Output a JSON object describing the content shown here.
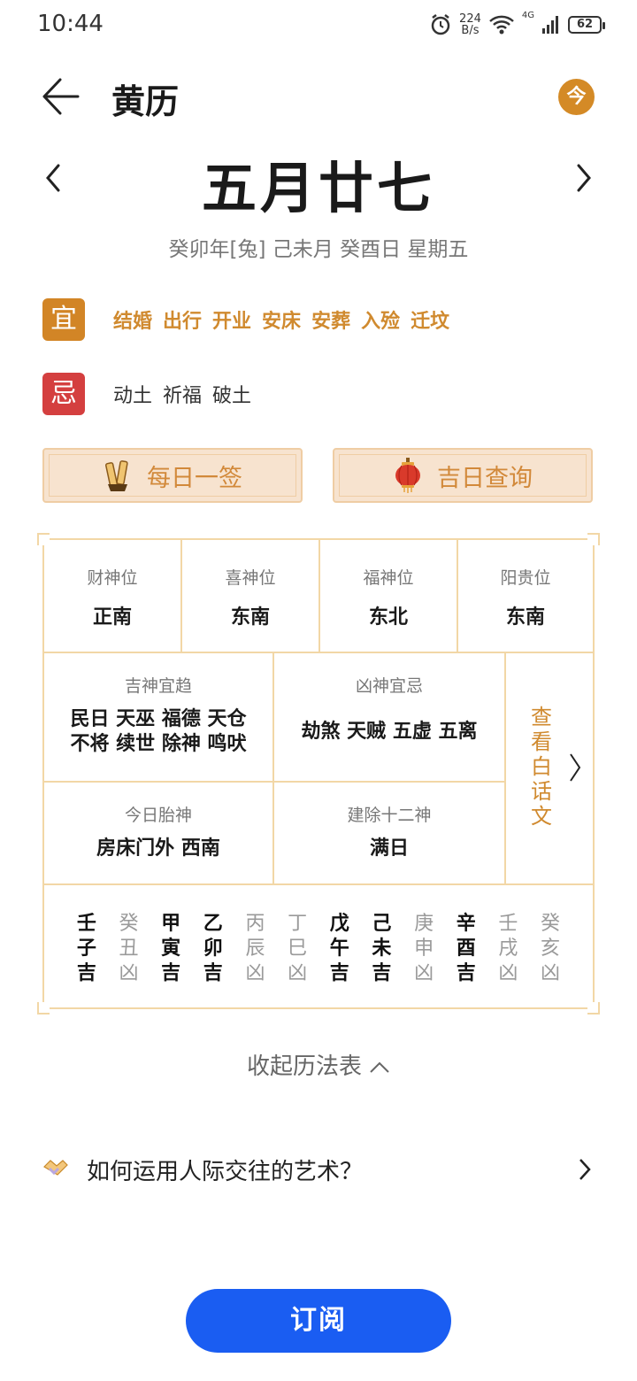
{
  "status_bar": {
    "time": "10:44",
    "net_speed_value": "224",
    "net_speed_unit": "B/s",
    "network": "4G",
    "battery": "62"
  },
  "header": {
    "title": "黄历",
    "today_label": "今"
  },
  "date": {
    "lunar": "五月廿七",
    "ganzhi": "癸卯年[兔] 己未月 癸酉日 星期五"
  },
  "yi": {
    "label": "宜",
    "items": [
      "结婚",
      "出行",
      "开业",
      "安床",
      "安葬",
      "入殓",
      "迁坟"
    ]
  },
  "ji": {
    "label": "忌",
    "items": [
      "动土",
      "祈福",
      "破土"
    ]
  },
  "actions": {
    "daily_lot": "每日一签",
    "lucky_day": "吉日查询"
  },
  "positions": [
    {
      "label": "财神位",
      "value": "正南"
    },
    {
      "label": "喜神位",
      "value": "东南"
    },
    {
      "label": "福神位",
      "value": "东北"
    },
    {
      "label": "阳贵位",
      "value": "东南"
    }
  ],
  "jishen": {
    "label": "吉神宜趋",
    "line1": "民日 天巫 福德 天仓",
    "line2": "不将 续世 除神 鸣吠"
  },
  "xiongshen": {
    "label": "凶神宜忌",
    "value": "劫煞 天贼 五虚 五离"
  },
  "taishen": {
    "label": "今日胎神",
    "value": "房床门外 西南"
  },
  "jianchu": {
    "label": "建除十二神",
    "value": "满日"
  },
  "vernacular": {
    "label": "查看白话文"
  },
  "hours": [
    {
      "stem": "壬",
      "branch": "子",
      "luck": "吉"
    },
    {
      "stem": "癸",
      "branch": "丑",
      "luck": "凶"
    },
    {
      "stem": "甲",
      "branch": "寅",
      "luck": "吉"
    },
    {
      "stem": "乙",
      "branch": "卯",
      "luck": "吉"
    },
    {
      "stem": "丙",
      "branch": "辰",
      "luck": "凶"
    },
    {
      "stem": "丁",
      "branch": "巳",
      "luck": "凶"
    },
    {
      "stem": "戊",
      "branch": "午",
      "luck": "吉"
    },
    {
      "stem": "己",
      "branch": "未",
      "luck": "吉"
    },
    {
      "stem": "庚",
      "branch": "申",
      "luck": "凶"
    },
    {
      "stem": "辛",
      "branch": "酉",
      "luck": "吉"
    },
    {
      "stem": "壬",
      "branch": "戌",
      "luck": "凶"
    },
    {
      "stem": "癸",
      "branch": "亥",
      "luck": "凶"
    }
  ],
  "collapse": {
    "label": "收起历法表"
  },
  "tip": {
    "text": "如何运用人际交往的艺术？"
  },
  "subscribe": {
    "label": "订阅"
  },
  "colors": {
    "accent": "#d48a26",
    "yi_badge": "#d28526",
    "ji_badge": "#d43f3f",
    "table_border": "#f2d7a6",
    "subscribe": "#1a5df2"
  }
}
